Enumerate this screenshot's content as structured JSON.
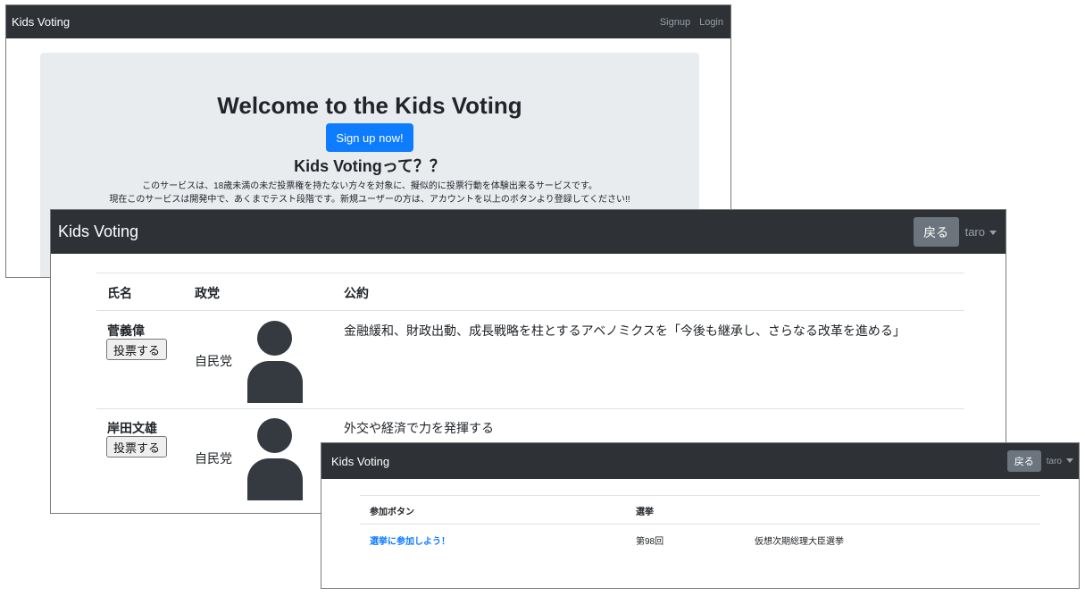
{
  "w1": {
    "brand": "Kids Voting",
    "nav_signup": "Signup",
    "nav_login": "Login",
    "heading": "Welcome to the Kids Voting",
    "signup_button": "Sign up now!",
    "subheading": "Kids Votingって？？",
    "desc1": "このサービスは、18歳未満の未だ投票権を持たない方々を対象に、擬似的に投票行動を体験出来るサービスです。",
    "desc2": "現在このサービスは開発中で、あくまでテスト段階です。新規ユーザーの方は、アカウントを以上のボタンより登録してください!!"
  },
  "w2": {
    "brand": "Kids Voting",
    "back_button": "戻る",
    "user": "taro",
    "headers": [
      "氏名",
      "政党",
      "公約"
    ],
    "rows": [
      {
        "name": "菅義偉",
        "vote": "投票する",
        "party": "自民党",
        "pledge": "金融緩和、財政出動、成長戦略を柱とするアベノミクスを「今後も継承し、さらなる改革を進める」"
      },
      {
        "name": "岸田文雄",
        "vote": "投票する",
        "party": "自民党",
        "pledge": "外交や経済で力を発揮する"
      }
    ]
  },
  "w3": {
    "brand": "Kids Voting",
    "back_button": "戻る",
    "user": "taro",
    "headers": [
      "参加ボタン",
      "選挙"
    ],
    "rows": [
      {
        "join": "選挙に参加しよう！",
        "round": "第98回",
        "election": "仮想次期総理大臣選挙"
      }
    ]
  }
}
